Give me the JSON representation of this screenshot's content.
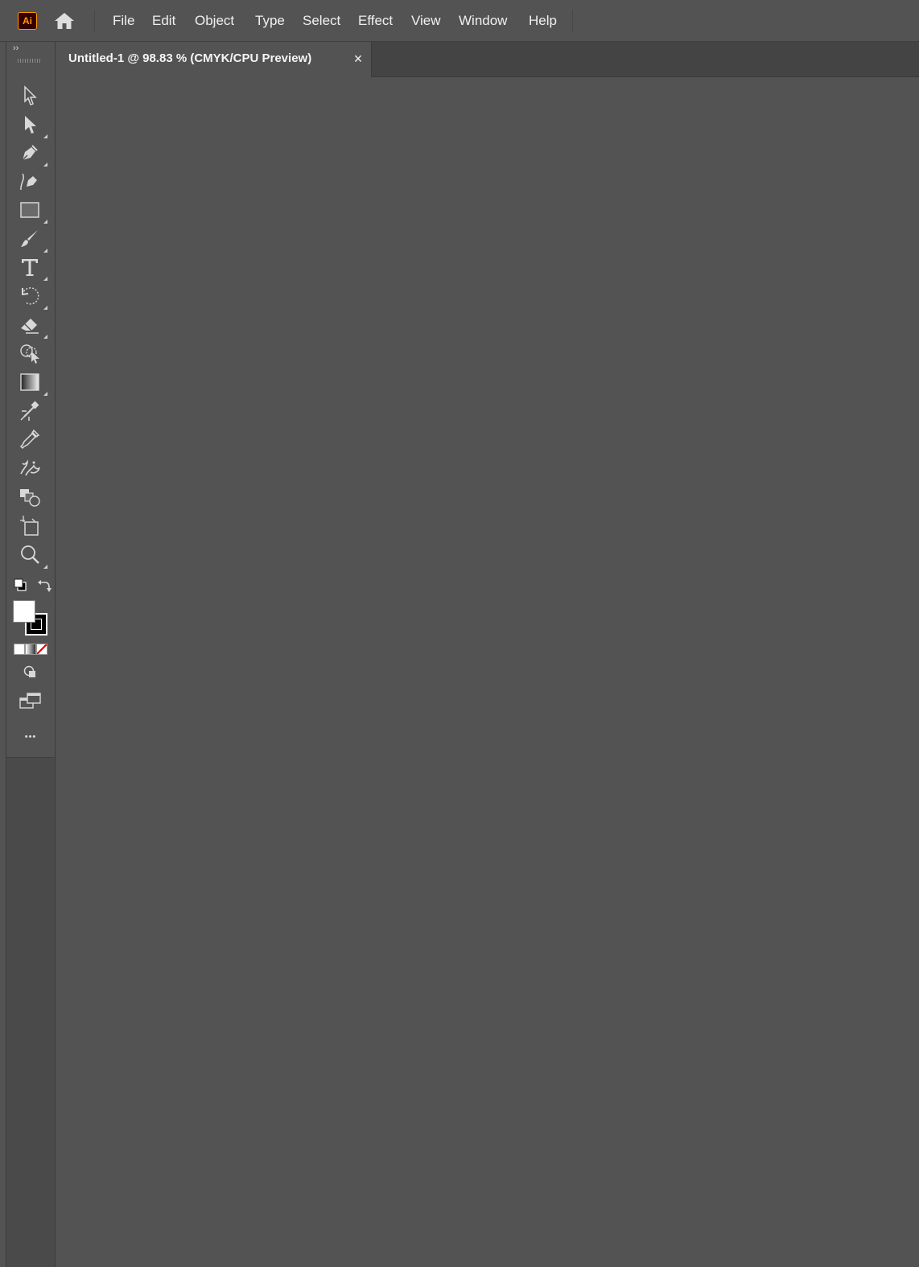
{
  "app": {
    "logo_text": "Ai",
    "accent_color": "#ff9a00"
  },
  "menu": {
    "items": [
      "File",
      "Edit",
      "Object",
      "Type",
      "Select",
      "Effect",
      "View",
      "Window",
      "Help"
    ]
  },
  "document_tab": {
    "title": "Untitled-1 @ 98.83 % (CMYK/CPU Preview)",
    "close_label": "×"
  },
  "toolbar": {
    "collapse_label": "››",
    "more_label": "•••",
    "tools": [
      "selection-tool-icon",
      "direct-selection-tool-icon",
      "pen-tool-icon",
      "curvature-tool-icon",
      "rectangle-tool-icon",
      "paintbrush-tool-icon",
      "type-tool-icon",
      "rotate-tool-icon",
      "eraser-tool-icon",
      "shape-builder-tool-icon",
      "gradient-tool-icon",
      "blend-tool-icon",
      "eyedropper-tool-icon",
      "symbol-sprayer-tool-icon",
      "live-paint-tool-icon",
      "artboard-tool-icon",
      "zoom-tool-icon"
    ],
    "fill_color": "#ffffff",
    "stroke_color": "#000000"
  }
}
